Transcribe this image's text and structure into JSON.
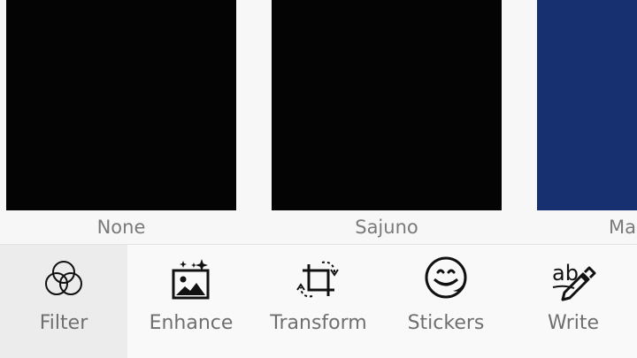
{
  "filters": [
    {
      "label": "None",
      "color": "#050405"
    },
    {
      "label": "Sajuno",
      "color": "#050405"
    },
    {
      "label": "Ma",
      "color": "#17306f"
    }
  ],
  "toolbar": {
    "items": [
      {
        "label": "Filter",
        "icon": "filter-icon",
        "active": true
      },
      {
        "label": "Enhance",
        "icon": "enhance-icon",
        "active": false
      },
      {
        "label": "Transform",
        "icon": "transform-icon",
        "active": false
      },
      {
        "label": "Stickers",
        "icon": "stickers-icon",
        "active": false
      },
      {
        "label": "Write",
        "icon": "write-icon",
        "active": false
      }
    ]
  },
  "colors": {
    "background": "#f7f7f7",
    "active_tab": "#ececec",
    "label_text": "#7a7a7a"
  }
}
